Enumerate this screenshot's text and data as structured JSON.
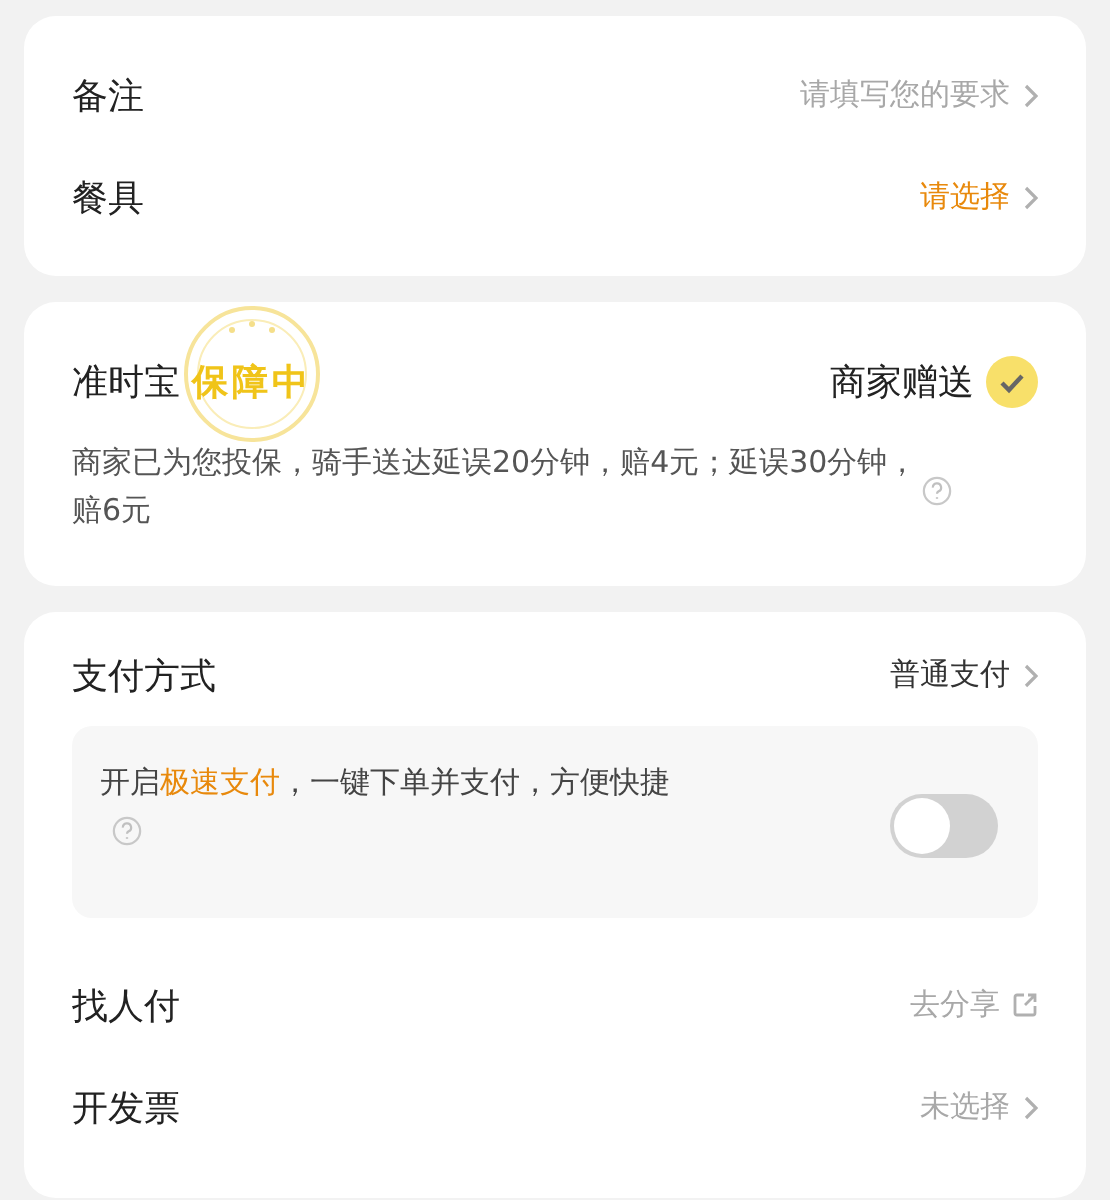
{
  "remark_card": {
    "rows": [
      {
        "label": "备注",
        "value": "请填写您的要求",
        "kind": "hint"
      },
      {
        "label": "餐具",
        "value": "请选择",
        "kind": "prompt"
      }
    ]
  },
  "insurance": {
    "title": "准时宝",
    "stamp": "保障中",
    "gift_label": "商家赠送",
    "checked": true,
    "description": "商家已为您投保，骑手送达延误20分钟，赔4元；延误30分钟，赔6元"
  },
  "payment_card": {
    "method": {
      "label": "支付方式",
      "value": "普通支付",
      "kind": "value"
    },
    "promo": {
      "text": "开启**极速支付**，一键下单并支付，方便快捷",
      "on": false
    },
    "rows": [
      {
        "label": "找人付",
        "value": "去分享",
        "kind": "share"
      },
      {
        "label": "开发票",
        "value": "未选择",
        "kind": "hint"
      }
    ]
  }
}
